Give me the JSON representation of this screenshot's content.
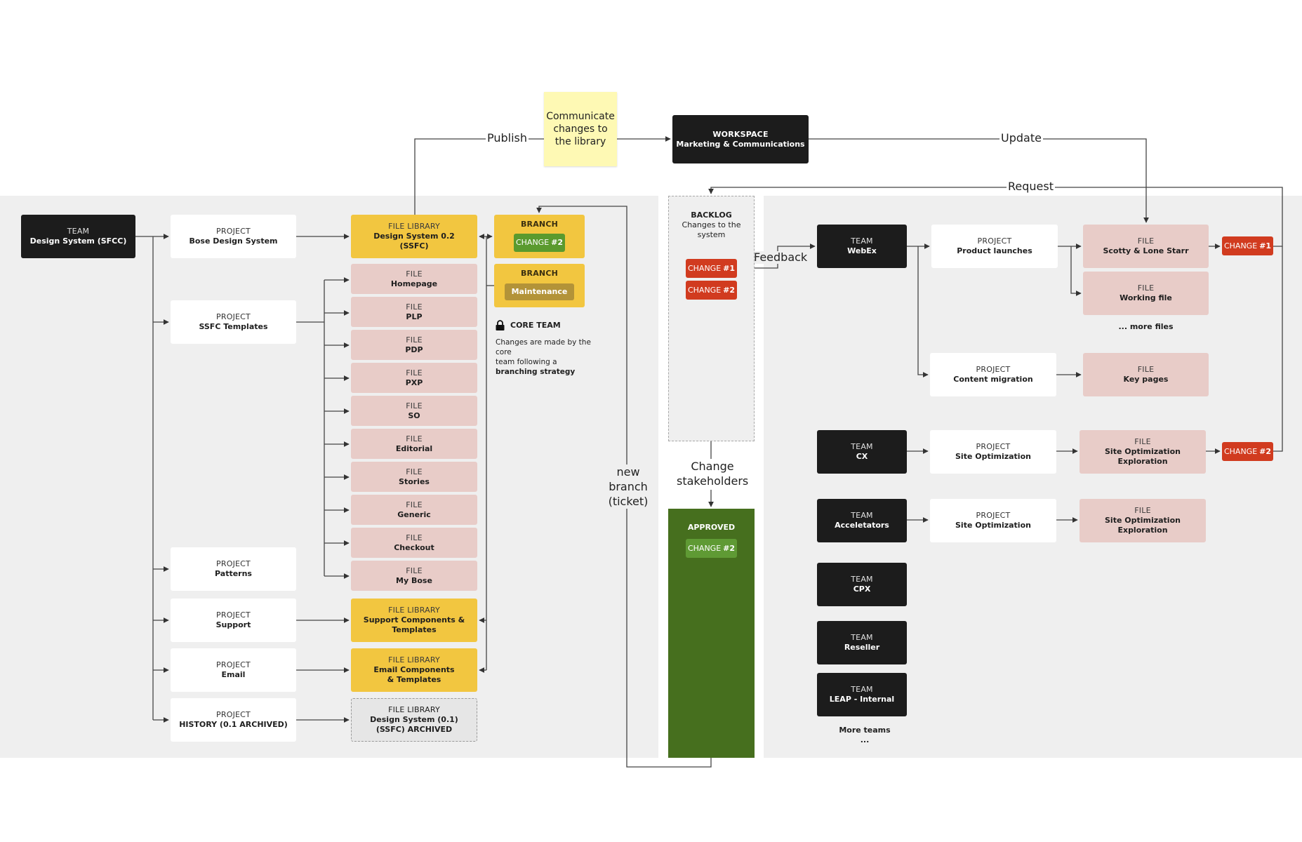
{
  "colors": {
    "team": "#1c1c1c",
    "project": "#ffffff",
    "file_library": "#f2c640",
    "file": "#e8ccc8",
    "change_red": "#d13b1f",
    "change_green": "#5a9a2e",
    "approved": "#466f1e",
    "sticky": "#fef9b4",
    "band": "#efefef"
  },
  "sticky": {
    "text": "Communicate changes to the library"
  },
  "workspace": {
    "kind": "WORKSPACE",
    "name": "Marketing & Communications"
  },
  "edge_labels": {
    "publish": "Publish",
    "update": "Update",
    "request": "Request",
    "feedback": "Feedback",
    "new_branch_1": "new",
    "new_branch_2": "branch",
    "new_branch_3": "(ticket)",
    "change_stakeholders_1": "Change",
    "change_stakeholders_2": "stakeholders"
  },
  "left": {
    "team": {
      "kind": "TEAM",
      "name": "Design System (SFCC)"
    },
    "projects": [
      {
        "kind": "PROJECT",
        "name": "Bose Design System"
      },
      {
        "kind": "PROJECT",
        "name": "SSFC Templates"
      },
      {
        "kind": "PROJECT",
        "name": "Patterns"
      },
      {
        "kind": "PROJECT",
        "name": "Support"
      },
      {
        "kind": "PROJECT",
        "name": "Email"
      },
      {
        "kind": "PROJECT",
        "name": "HISTORY (0.1 ARCHIVED)"
      }
    ],
    "main_library": {
      "kind": "FILE LIBRARY",
      "name1": "Design System 0.2",
      "name2": "(SSFC)"
    },
    "files": [
      {
        "kind": "FILE",
        "name": "Homepage"
      },
      {
        "kind": "FILE",
        "name": "PLP"
      },
      {
        "kind": "FILE",
        "name": "PDP"
      },
      {
        "kind": "FILE",
        "name": "PXP"
      },
      {
        "kind": "FILE",
        "name": "SO"
      },
      {
        "kind": "FILE",
        "name": "Editorial"
      },
      {
        "kind": "FILE",
        "name": "Stories"
      },
      {
        "kind": "FILE",
        "name": "Generic"
      },
      {
        "kind": "FILE",
        "name": "Checkout"
      },
      {
        "kind": "FILE",
        "name": "My Bose"
      }
    ],
    "support_library": {
      "kind": "FILE LIBRARY",
      "name1": "Support Components &",
      "name2": "Templates"
    },
    "email_library": {
      "kind": "FILE LIBRARY",
      "name1": "Email Components",
      "name2": "& Templates"
    },
    "archived_library": {
      "kind": "FILE LIBRARY",
      "name1": "Design System (0.1)",
      "name2": "(SSFC) ARCHIVED"
    },
    "branches": [
      {
        "kind": "BRANCH",
        "chip_prefix": "CHANGE",
        "chip_num": "#2"
      },
      {
        "kind": "BRANCH",
        "chip_label": "Maintenance"
      }
    ],
    "core_team": {
      "title": "CORE TEAM",
      "line1": "Changes are made by the core",
      "line2": "team following a",
      "line3": "branching strategy"
    }
  },
  "backlog": {
    "title": "BACKLOG",
    "subtitle1": "Changes to the",
    "subtitle2": "system",
    "items": [
      {
        "prefix": "CHANGE",
        "num": "#1"
      },
      {
        "prefix": "CHANGE",
        "num": "#2"
      }
    ]
  },
  "approved": {
    "title": "APPROVED",
    "items": [
      {
        "prefix": "CHANGE",
        "num": "#2"
      }
    ]
  },
  "right": {
    "webex": {
      "team": {
        "kind": "TEAM",
        "name": "WebEx"
      },
      "project1": {
        "kind": "PROJECT",
        "name": "Product launches"
      },
      "file1": {
        "kind": "FILE",
        "name": "Scotty & Lone Starr"
      },
      "file2": {
        "kind": "FILE",
        "name": "Working file"
      },
      "more_files": "... more files",
      "change": {
        "prefix": "CHANGE",
        "num": "#1"
      },
      "project2": {
        "kind": "PROJECT",
        "name": "Content migration"
      },
      "file3": {
        "kind": "FILE",
        "name": "Key pages"
      }
    },
    "cx": {
      "team": {
        "kind": "TEAM",
        "name": "CX"
      },
      "project": {
        "kind": "PROJECT",
        "name": "Site Optimization"
      },
      "file": {
        "kind": "FILE",
        "name1": "Site Optimization",
        "name2": "Exploration"
      },
      "change": {
        "prefix": "CHANGE",
        "num": "#2"
      }
    },
    "accelerators": {
      "team": {
        "kind": "TEAM",
        "name": "Acceletators"
      },
      "project": {
        "kind": "PROJECT",
        "name": "Site Optimization"
      },
      "file": {
        "kind": "FILE",
        "name1": "Site Optimization",
        "name2": "Exploration"
      }
    },
    "other_teams": [
      {
        "kind": "TEAM",
        "name": "CPX"
      },
      {
        "kind": "TEAM",
        "name": "Reseller"
      },
      {
        "kind": "TEAM",
        "name": "LEAP - Internal"
      }
    ],
    "more_teams": "More teams",
    "more_teams_ellipsis": "..."
  }
}
